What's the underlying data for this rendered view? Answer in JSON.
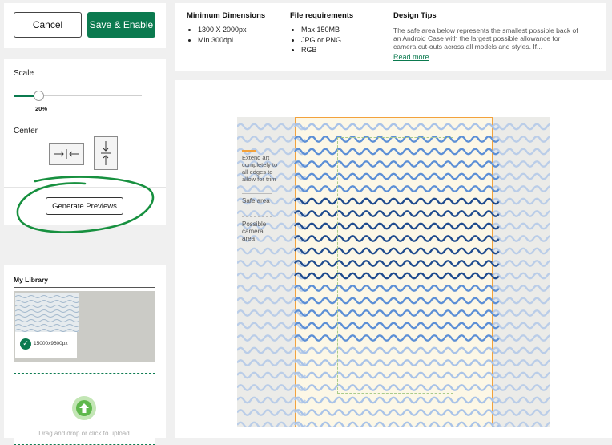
{
  "actions": {
    "cancel_label": "Cancel",
    "save_label": "Save & Enable"
  },
  "scale": {
    "label": "Scale",
    "value_label": "20%",
    "value": 0.2
  },
  "center": {
    "label": "Center"
  },
  "preview": {
    "generate_label": "Generate Previews"
  },
  "library": {
    "title": "My Library",
    "items": [
      {
        "dimensions": "15000x9600px",
        "selected": true
      }
    ],
    "upload_text": "Drag and drop or click to upload"
  },
  "requirements": {
    "min_dimensions": {
      "title": "Minimum Dimensions",
      "items": [
        "1300 X 2000px",
        "Min 300dpi"
      ]
    },
    "file_requirements": {
      "title": "File requirements",
      "items": [
        "Max 150MB",
        "JPG or PNG",
        "RGB"
      ]
    },
    "design_tips": {
      "title": "Design Tips",
      "line1": "The safe area below represents the smallest possible back of",
      "line2": "an Android Case with the largest possible allowance for",
      "line3": "camera cut-outs across all models and styles. If...",
      "read_more": "Read more"
    }
  },
  "legend": {
    "extend_line1": "Extend art",
    "extend_line2": "completely to",
    "extend_line3": "all edges to",
    "extend_line4": "allow for trim",
    "safe_area": "Safe area",
    "camera_line1": "Possible",
    "camera_line2": "camera",
    "camera_line3": "area"
  },
  "colors": {
    "primary": "#0b7a4f",
    "annotation_circle": "#17903f",
    "trim_line": "#f3a23c",
    "wave_light": "#a9c3e8",
    "wave_mid": "#5c8fd6",
    "wave_dark": "#1f4b8e"
  }
}
